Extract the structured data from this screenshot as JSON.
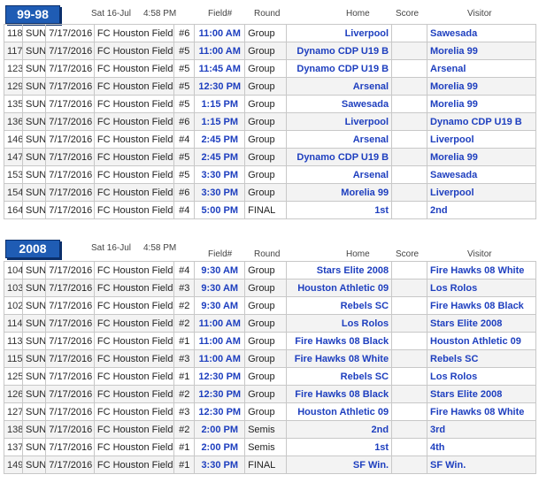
{
  "columns": {
    "field": "Field#",
    "round": "Round",
    "home": "Home",
    "score": "Score",
    "visitor": "Visitor"
  },
  "sections": [
    {
      "title": "99-98",
      "date": "Sat 16-Jul",
      "time": "4:58 PM",
      "rows": [
        {
          "game": "118",
          "day": "SUN",
          "date": "7/17/2016",
          "venue": "FC Houston Fields",
          "field": "#6",
          "time": "11:00 AM",
          "round": "Group",
          "home": "Liverpool",
          "score": "",
          "visitor": "Sawesada"
        },
        {
          "game": "117",
          "day": "SUN",
          "date": "7/17/2016",
          "venue": "FC Houston Fields",
          "field": "#5",
          "time": "11:00 AM",
          "round": "Group",
          "home": "Dynamo CDP U19 B",
          "score": "",
          "visitor": "Morelia 99"
        },
        {
          "game": "123",
          "day": "SUN",
          "date": "7/17/2016",
          "venue": "FC Houston Fields",
          "field": "#5",
          "time": "11:45 AM",
          "round": "Group",
          "home": "Dynamo CDP U19 B",
          "score": "",
          "visitor": "Arsenal"
        },
        {
          "game": "129",
          "day": "SUN",
          "date": "7/17/2016",
          "venue": "FC Houston Fields",
          "field": "#5",
          "time": "12:30 PM",
          "round": "Group",
          "home": "Arsenal",
          "score": "",
          "visitor": "Morelia 99"
        },
        {
          "game": "135",
          "day": "SUN",
          "date": "7/17/2016",
          "venue": "FC Houston Fields",
          "field": "#5",
          "time": "1:15 PM",
          "round": "Group",
          "home": "Sawesada",
          "score": "",
          "visitor": "Morelia 99"
        },
        {
          "game": "136",
          "day": "SUN",
          "date": "7/17/2016",
          "venue": "FC Houston Fields",
          "field": "#6",
          "time": "1:15 PM",
          "round": "Group",
          "home": "Liverpool",
          "score": "",
          "visitor": "Dynamo CDP U19 B"
        },
        {
          "game": "146",
          "day": "SUN",
          "date": "7/17/2016",
          "venue": "FC Houston Fields",
          "field": "#4",
          "time": "2:45 PM",
          "round": "Group",
          "home": "Arsenal",
          "score": "",
          "visitor": "Liverpool"
        },
        {
          "game": "147",
          "day": "SUN",
          "date": "7/17/2016",
          "venue": "FC Houston Fields",
          "field": "#5",
          "time": "2:45 PM",
          "round": "Group",
          "home": "Dynamo CDP U19 B",
          "score": "",
          "visitor": "Morelia 99"
        },
        {
          "game": "153",
          "day": "SUN",
          "date": "7/17/2016",
          "venue": "FC Houston Fields",
          "field": "#5",
          "time": "3:30 PM",
          "round": "Group",
          "home": "Arsenal",
          "score": "",
          "visitor": "Sawesada"
        },
        {
          "game": "154",
          "day": "SUN",
          "date": "7/17/2016",
          "venue": "FC Houston Fields",
          "field": "#6",
          "time": "3:30 PM",
          "round": "Group",
          "home": "Morelia 99",
          "score": "",
          "visitor": "Liverpool"
        },
        {
          "game": "164",
          "day": "SUN",
          "date": "7/17/2016",
          "venue": "FC Houston Fields",
          "field": "#4",
          "time": "5:00 PM",
          "round": "FINAL",
          "home": "1st",
          "score": "",
          "visitor": "2nd"
        }
      ]
    },
    {
      "title": "2008",
      "date": "Sat 16-Jul",
      "time": "4:58 PM",
      "rows": [
        {
          "game": "104",
          "day": "SUN",
          "date": "7/17/2016",
          "venue": "FC Houston Fields",
          "field": "#4",
          "time": "9:30 AM",
          "round": "Group",
          "home": "Stars Elite 2008",
          "score": "",
          "visitor": "Fire Hawks 08 White"
        },
        {
          "game": "103",
          "day": "SUN",
          "date": "7/17/2016",
          "venue": "FC Houston Fields",
          "field": "#3",
          "time": "9:30 AM",
          "round": "Group",
          "home": "Houston Athletic 09",
          "score": "",
          "visitor": "Los Rolos"
        },
        {
          "game": "102",
          "day": "SUN",
          "date": "7/17/2016",
          "venue": "FC Houston Fields",
          "field": "#2",
          "time": "9:30 AM",
          "round": "Group",
          "home": "Rebels SC",
          "score": "",
          "visitor": "Fire Hawks 08 Black"
        },
        {
          "game": "114",
          "day": "SUN",
          "date": "7/17/2016",
          "venue": "FC Houston Fields",
          "field": "#2",
          "time": "11:00 AM",
          "round": "Group",
          "home": "Los Rolos",
          "score": "",
          "visitor": "Stars Elite 2008"
        },
        {
          "game": "113",
          "day": "SUN",
          "date": "7/17/2016",
          "venue": "FC Houston Fields",
          "field": "#1",
          "time": "11:00 AM",
          "round": "Group",
          "home": "Fire Hawks 08 Black",
          "score": "",
          "visitor": "Houston Athletic 09"
        },
        {
          "game": "115",
          "day": "SUN",
          "date": "7/17/2016",
          "venue": "FC Houston Fields",
          "field": "#3",
          "time": "11:00 AM",
          "round": "Group",
          "home": "Fire Hawks 08 White",
          "score": "",
          "visitor": "Rebels SC"
        },
        {
          "game": "125",
          "day": "SUN",
          "date": "7/17/2016",
          "venue": "FC Houston Fields",
          "field": "#1",
          "time": "12:30 PM",
          "round": "Group",
          "home": "Rebels SC",
          "score": "",
          "visitor": "Los Rolos"
        },
        {
          "game": "126",
          "day": "SUN",
          "date": "7/17/2016",
          "venue": "FC Houston Fields",
          "field": "#2",
          "time": "12:30 PM",
          "round": "Group",
          "home": "Fire Hawks 08 Black",
          "score": "",
          "visitor": "Stars Elite 2008"
        },
        {
          "game": "127",
          "day": "SUN",
          "date": "7/17/2016",
          "venue": "FC Houston Fields",
          "field": "#3",
          "time": "12:30 PM",
          "round": "Group",
          "home": "Houston Athletic 09",
          "score": "",
          "visitor": "Fire Hawks 08 White"
        },
        {
          "game": "138",
          "day": "SUN",
          "date": "7/17/2016",
          "venue": "FC Houston Fields",
          "field": "#2",
          "time": "2:00 PM",
          "round": "Semis",
          "home": "2nd",
          "score": "",
          "visitor": "3rd"
        },
        {
          "game": "137",
          "day": "SUN",
          "date": "7/17/2016",
          "venue": "FC Houston Fields",
          "field": "#1",
          "time": "2:00 PM",
          "round": "Semis",
          "home": "1st",
          "score": "",
          "visitor": "4th"
        },
        {
          "game": "149",
          "day": "SUN",
          "date": "7/17/2016",
          "venue": "FC Houston Fields",
          "field": "#1",
          "time": "3:30 PM",
          "round": "FINAL",
          "home": "SF Win.",
          "score": "",
          "visitor": "SF Win."
        }
      ]
    }
  ]
}
